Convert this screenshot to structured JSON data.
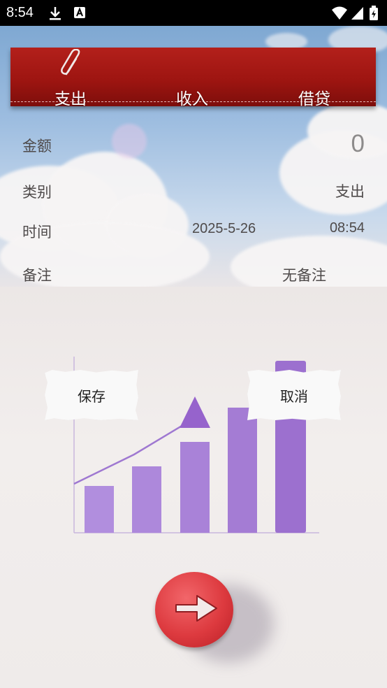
{
  "status_bar": {
    "time": "8:54",
    "icons": [
      "download-icon",
      "a-notification-icon",
      "wifi-icon",
      "signal-icon",
      "battery-icon"
    ]
  },
  "tabs": [
    {
      "label": "支出"
    },
    {
      "label": "收入"
    },
    {
      "label": "借贷"
    }
  ],
  "form": {
    "amount": {
      "label": "金额",
      "value": "0"
    },
    "category": {
      "label": "类别",
      "value": "支出"
    },
    "time": {
      "label": "时间",
      "date": "2025-5-26",
      "clock": "08:54"
    },
    "note": {
      "label": "备注",
      "value": "无备注"
    }
  },
  "actions": {
    "save_label": "保存",
    "cancel_label": "取消",
    "next_icon": "arrow-right-icon"
  },
  "colors": {
    "banner": "#a3170f",
    "bars": "#a97fd6",
    "go_button": "#dd3a3f"
  }
}
